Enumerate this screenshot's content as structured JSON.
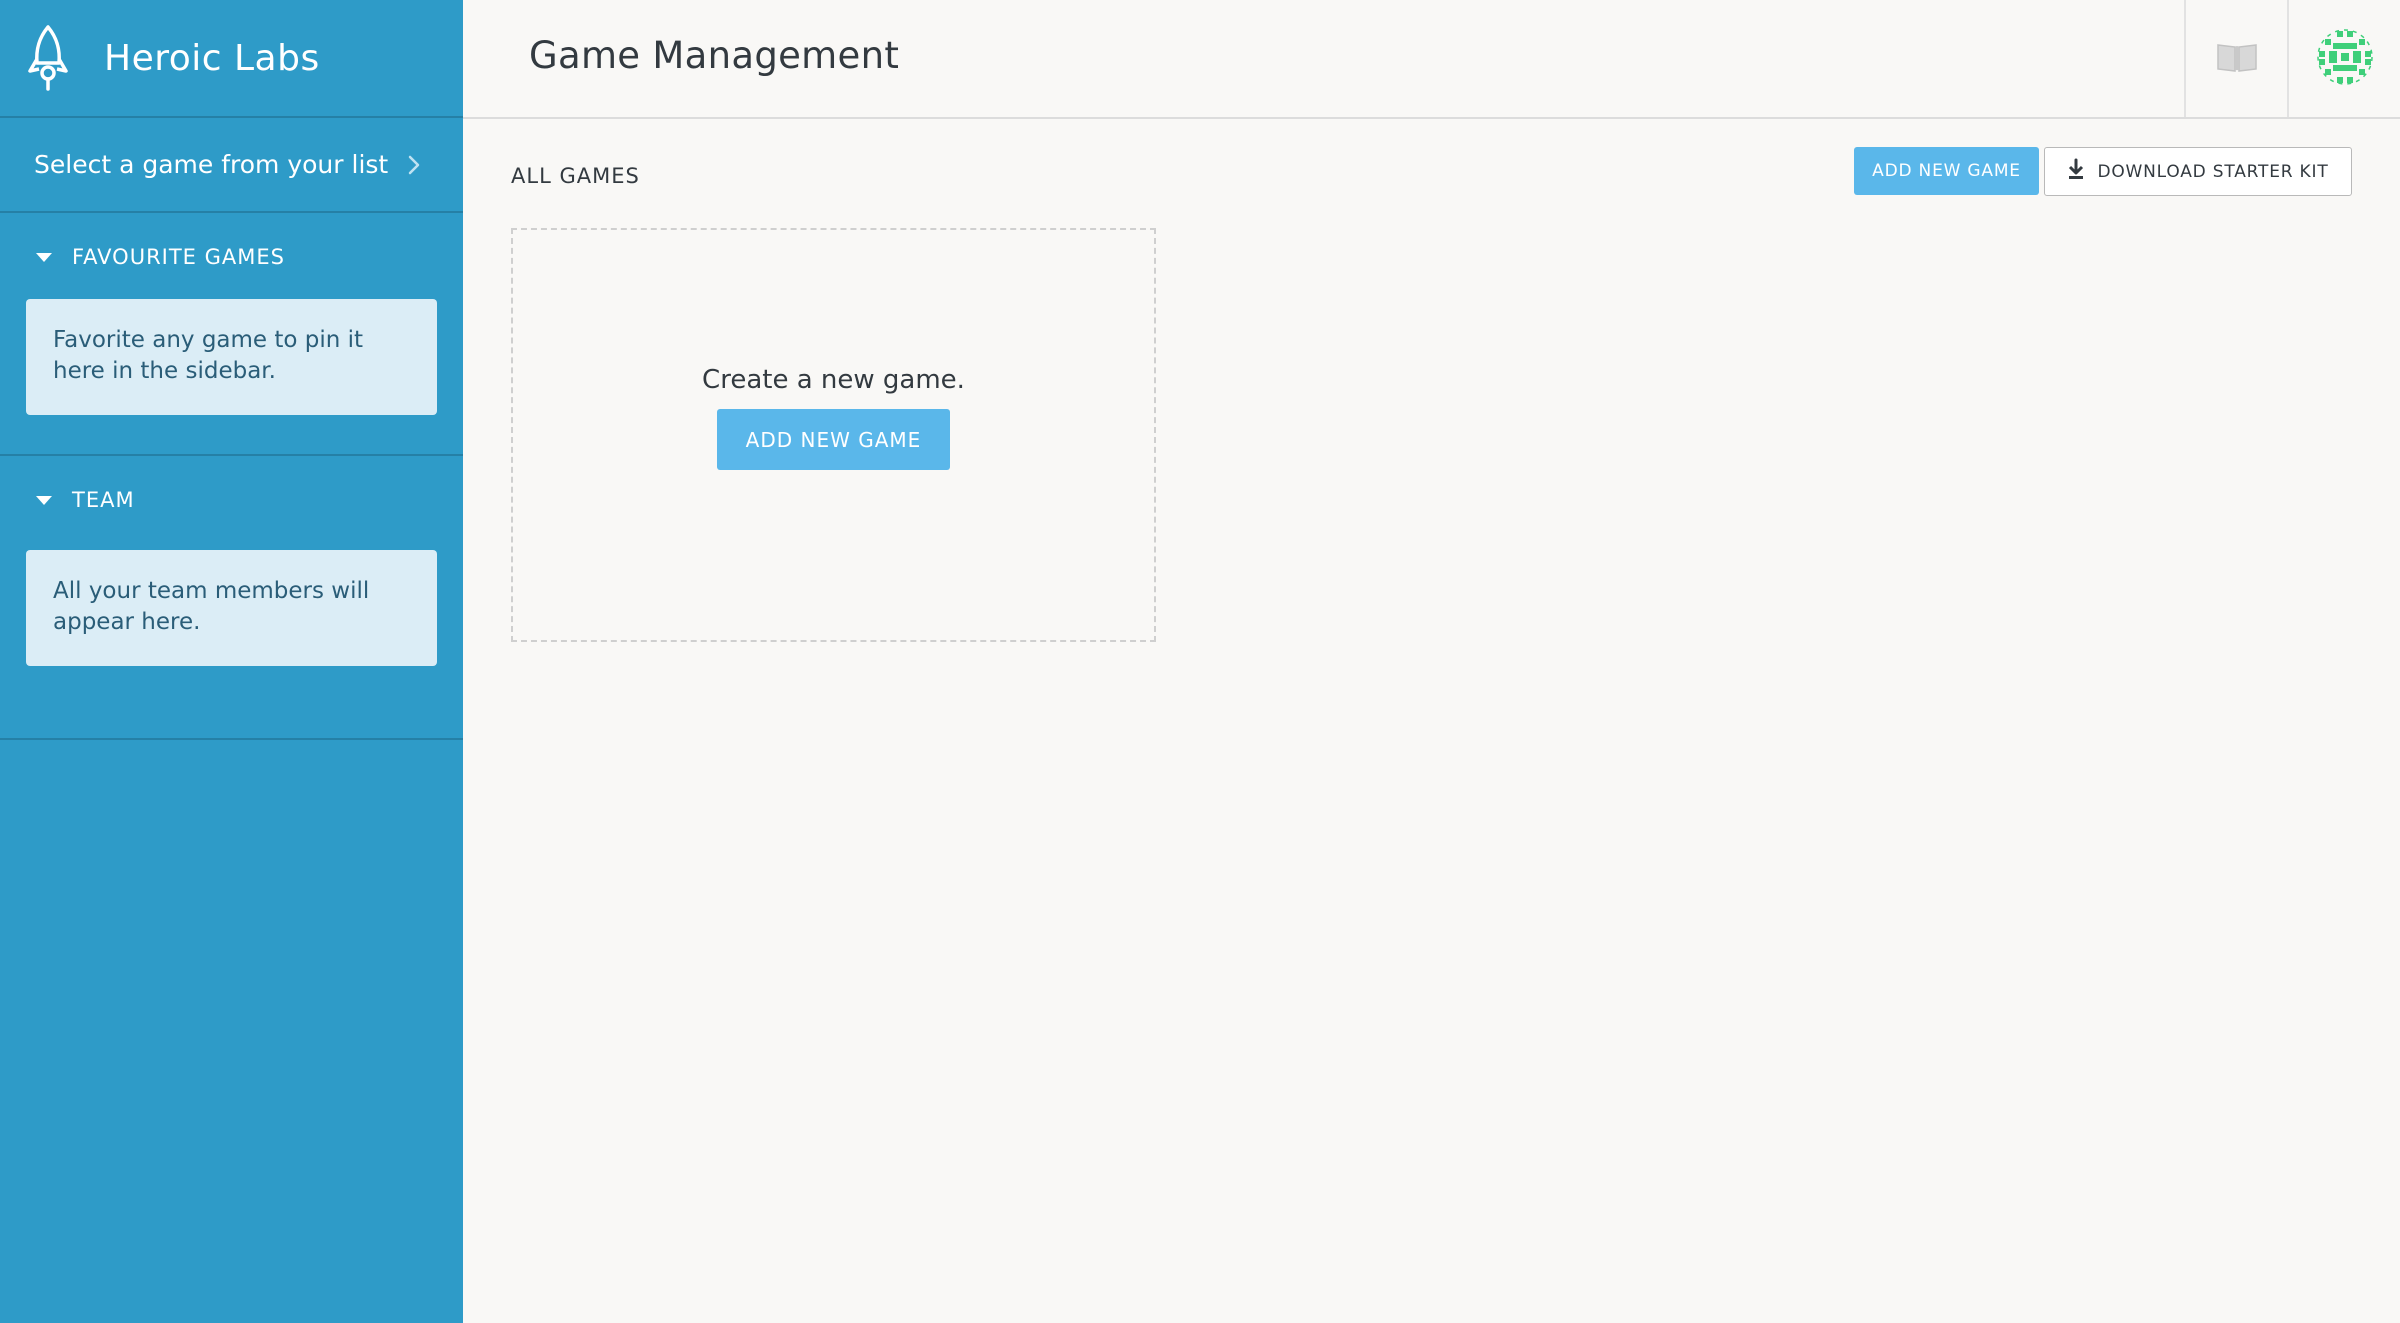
{
  "colors": {
    "sidebar_bg": "#2e9bc8",
    "accent_button": "#5ab7ea",
    "note_bg": "#dbedf6",
    "page_bg": "#f9f8f6",
    "avatar_green": "#3fcf7a"
  },
  "sidebar": {
    "brand": {
      "name": "Heroic Labs",
      "icon": "rocket-icon"
    },
    "game_select": {
      "label": "Select a game from your list",
      "icon": "chevron-right-icon"
    },
    "sections": [
      {
        "title": "FAVOURITE GAMES",
        "note": "Favorite any game to pin it here in the sidebar.",
        "icon": "caret-down-icon"
      },
      {
        "title": "TEAM",
        "note": "All your team members will appear here.",
        "icon": "caret-down-icon"
      }
    ]
  },
  "header": {
    "title": "Game Management",
    "docs_icon": "book-icon",
    "avatar_icon": "avatar-icon"
  },
  "main": {
    "section_title": "ALL GAMES",
    "toolbar": {
      "add_label": "ADD NEW GAME",
      "download_label": "DOWNLOAD STARTER KIT",
      "download_icon": "download-icon"
    },
    "empty_state": {
      "message": "Create a new game.",
      "button_label": "ADD NEW GAME"
    }
  }
}
